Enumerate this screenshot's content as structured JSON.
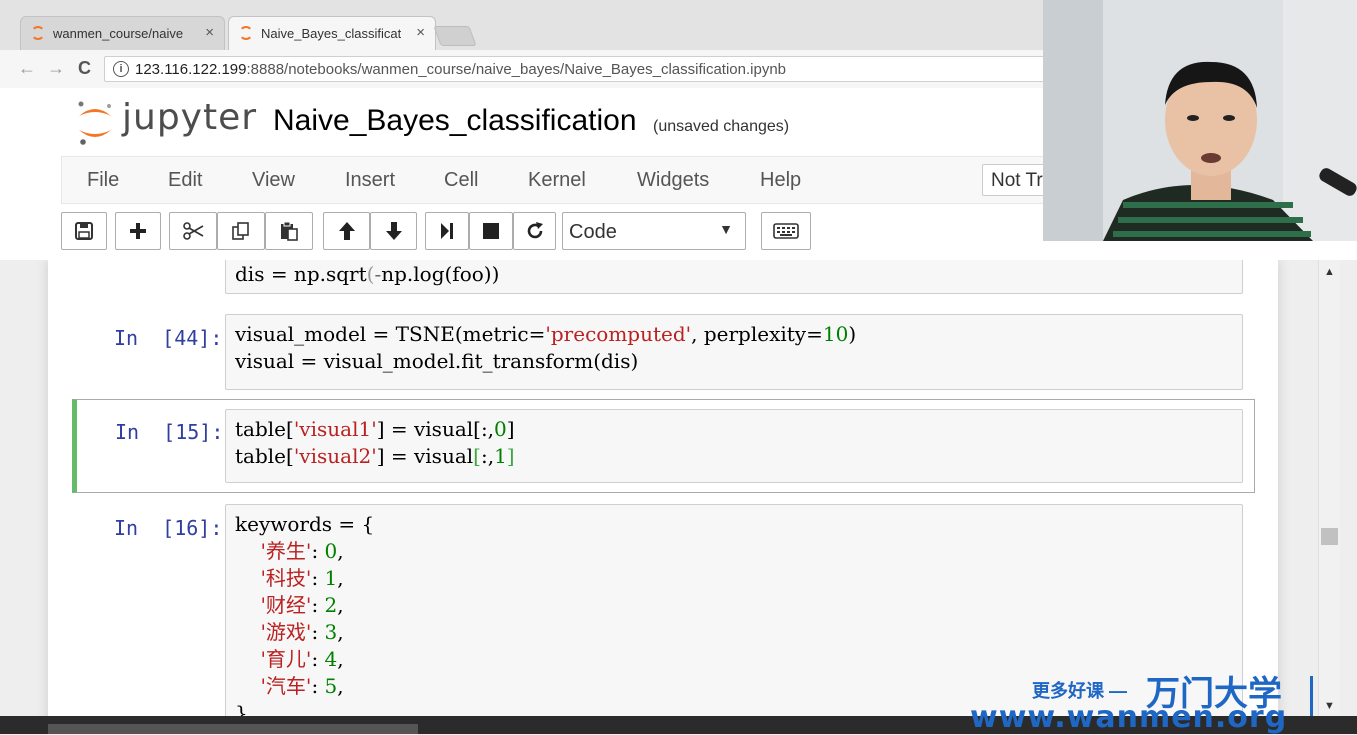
{
  "browser": {
    "tabs": [
      {
        "label": "wanmen_course/naive",
        "close": "×",
        "active": false
      },
      {
        "label": "Naive_Bayes_classificat",
        "close": "×",
        "active": true
      }
    ],
    "url_host": "123.116.122.199",
    "url_rest": ":8888/notebooks/wanmen_course/naive_bayes/Naive_Bayes_classification.ipynb",
    "back_icon": "←",
    "forward_icon": "→",
    "reload_icon": "C",
    "info_icon": "i"
  },
  "jupyter": {
    "logo_text": "jupyter",
    "notebook_title": "Naive_Bayes_classification",
    "status": "(unsaved changes)",
    "menu": [
      "File",
      "Edit",
      "View",
      "Insert",
      "Cell",
      "Kernel",
      "Widgets",
      "Help"
    ],
    "trust_label": "Not Trusted",
    "cell_type": "Code",
    "accent_color": "#f37726"
  },
  "cells": [
    {
      "prompt": "",
      "lines": [
        "dis = np.sqrt(-np.log(foo))"
      ]
    },
    {
      "prompt": "In  [44]:",
      "lines": [
        "visual_model = TSNE(metric='precomputed', perplexity=10)",
        "visual = visual_model.fit_transform(dis)"
      ]
    },
    {
      "prompt": "In  [15]:",
      "lines": [
        "table['visual1'] = visual[:,0]",
        "table['visual2'] = visual[:,1]"
      ]
    },
    {
      "prompt": "In  [16]:",
      "lines": [
        "keywords = {",
        "    '养生': 0,",
        "    '科技': 1,",
        "    '财经': 2,",
        "    '游戏': 3,",
        "    '育儿': 4,",
        "    '汽车': 5,",
        "}"
      ]
    }
  ],
  "watermark": {
    "tagline": "更多好课 —",
    "brand": "万门大学",
    "site": "www.wanmen.org"
  },
  "colors": {
    "prompt": "#303f9f",
    "string": "#ba2121",
    "number": "#008000",
    "selected_border": "#66bb6a",
    "watermark": "#1f67c4"
  }
}
